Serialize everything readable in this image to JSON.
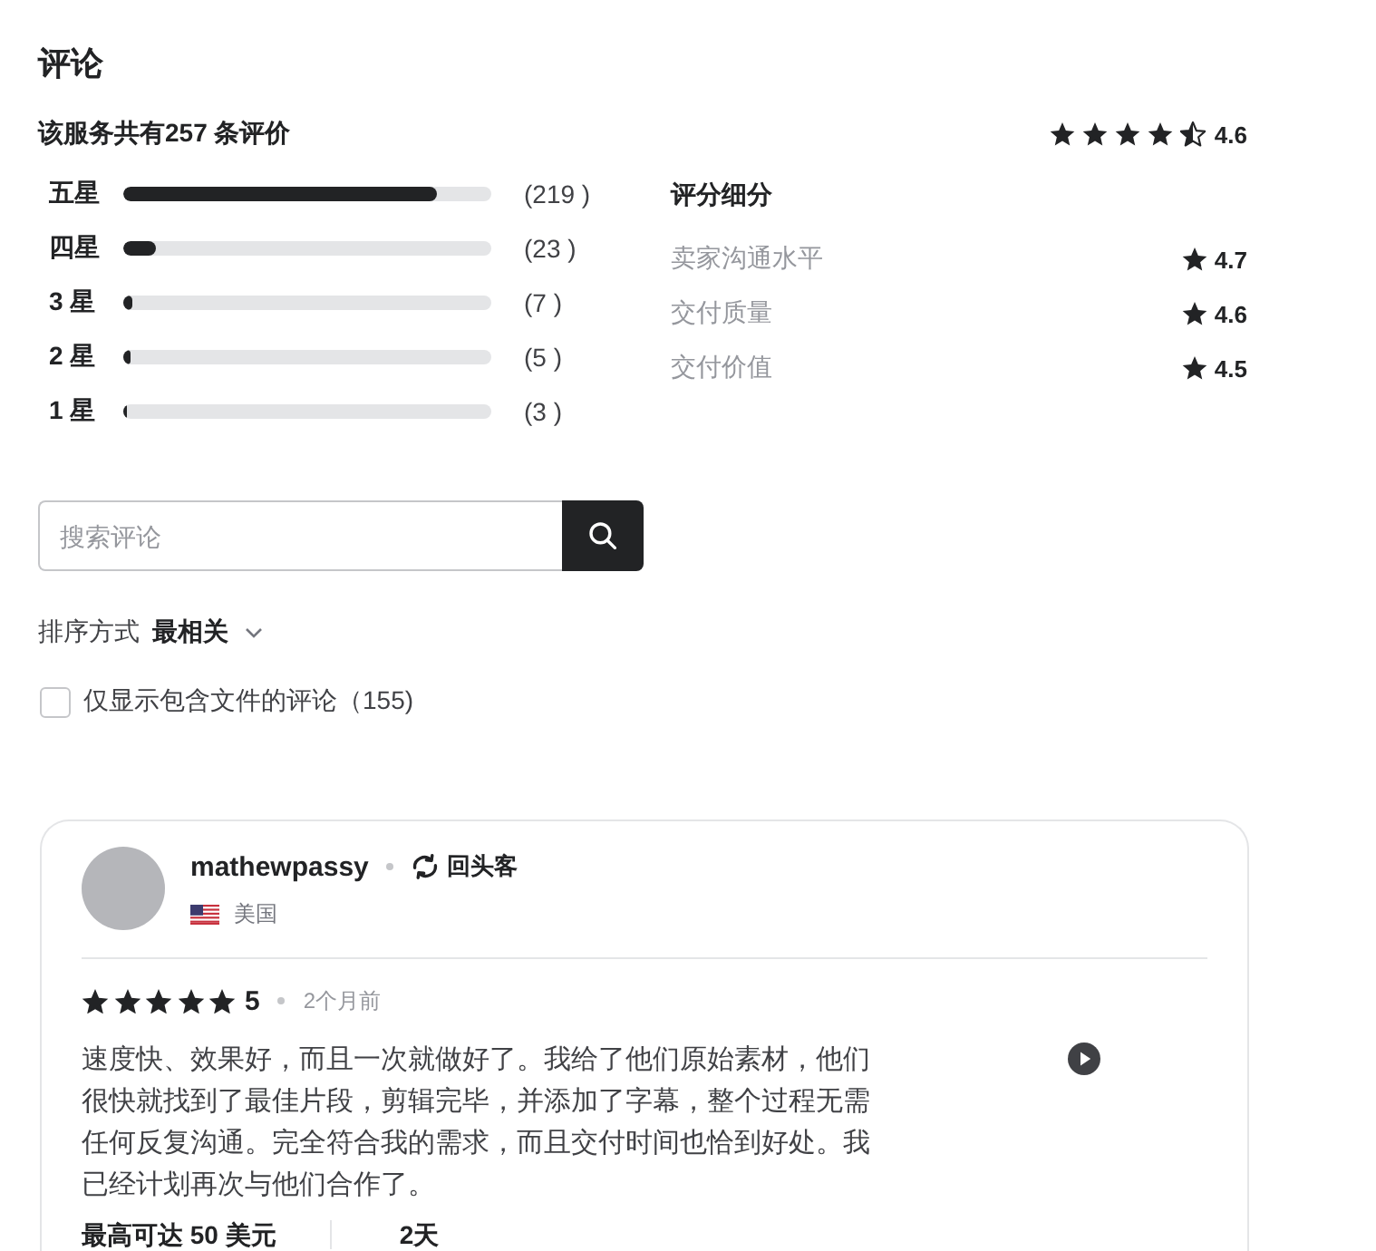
{
  "section": {
    "title": "评论"
  },
  "summary": {
    "heading": "该服务共有257 条评价",
    "stars": 4.5,
    "rating": "4.6"
  },
  "star_counts": [
    {
      "label": "五星",
      "level": 0.852,
      "count": "(219 )"
    },
    {
      "label": "四星",
      "level": 0.089,
      "count": "(23 )"
    },
    {
      "label": "3 星",
      "level": 0.027,
      "count": "(7 )"
    },
    {
      "label": "2 星",
      "level": 0.019,
      "count": "(5 )"
    },
    {
      "label": "1 星",
      "level": 0.012,
      "count": "(3 )"
    }
  ],
  "breakdown": {
    "title": "评分细分",
    "items": [
      {
        "label": "卖家沟通水平",
        "rating": "4.7"
      },
      {
        "label": "交付质量",
        "rating": "4.6"
      },
      {
        "label": "交付价值",
        "rating": "4.5"
      }
    ]
  },
  "search": {
    "placeholder": "搜索评论"
  },
  "sort": {
    "label": "排序方式",
    "value": "最相关"
  },
  "filter": {
    "label": "仅显示包含文件的评论（155)",
    "checked": false
  },
  "review": {
    "username": "mathewpassy",
    "badge": "回头客",
    "country": "美国",
    "stars": 5,
    "rating": "5",
    "time": "2个月前",
    "text": "速度快、效果好，而且一次就做好了。我给了他们原始素材，他们很快就找到了最佳片段，剪辑完毕，并添加了字幕，整个过程无需任何反复沟通。完全符合我的需求，而且交付时间也恰到好处。我已经计划再次与他们合作了。",
    "price": "最高可达 50 美元",
    "duration": "2天"
  }
}
